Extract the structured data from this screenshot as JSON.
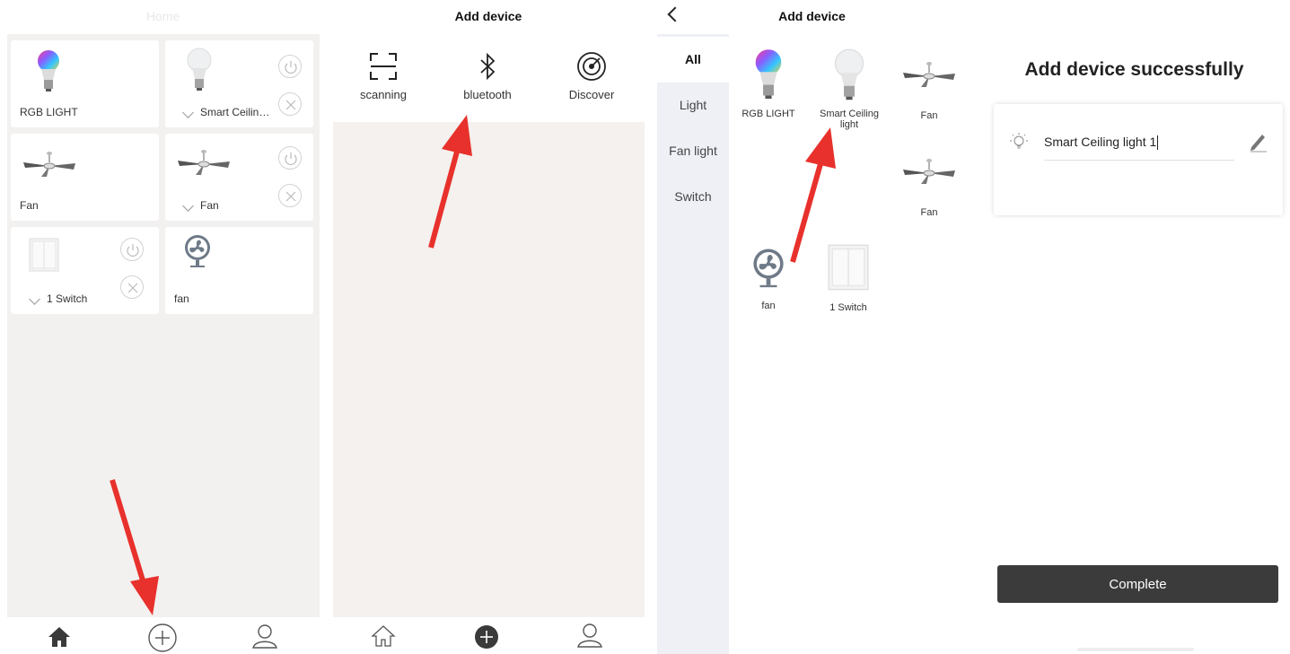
{
  "panel1": {
    "title": "Home",
    "devices": [
      {
        "label": "RGB LIGHT"
      },
      {
        "label": "Smart Ceilin…"
      },
      {
        "label": "Fan"
      },
      {
        "label": "Fan"
      },
      {
        "label": "1 Switch"
      },
      {
        "label": "fan"
      }
    ]
  },
  "panel2": {
    "title": "Add device",
    "options": [
      {
        "label": "scanning",
        "icon": "scan-icon"
      },
      {
        "label": "bluetooth",
        "icon": "bluetooth-icon"
      },
      {
        "label": "Discover",
        "icon": "radar-icon"
      }
    ]
  },
  "panel3": {
    "title": "Add device",
    "categories": [
      {
        "label": "All"
      },
      {
        "label": "Light"
      },
      {
        "label": "Fan light"
      },
      {
        "label": "Switch"
      }
    ],
    "devices": [
      {
        "label": "RGB LIGHT"
      },
      {
        "label": "Smart Ceiling light"
      },
      {
        "label": "Fan"
      },
      {
        "label": "Fan"
      },
      {
        "label": "fan"
      },
      {
        "label": "1 Switch"
      }
    ]
  },
  "panel4": {
    "title": "Add device successfully",
    "device_name": "Smart Ceiling light 1",
    "complete_label": "Complete"
  },
  "colors": {
    "arrow": "#e8312c",
    "content_bg": "#f3f1f0",
    "category_bg": "#eef0f6",
    "complete_button": "#3b3b3b"
  }
}
